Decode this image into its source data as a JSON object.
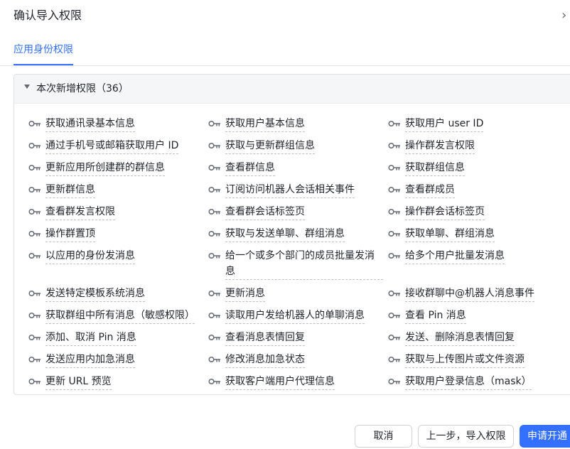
{
  "dialog": {
    "title": "确认导入权限",
    "close_icon": "chevron-right-icon"
  },
  "tabs": [
    {
      "label": "应用身份权限",
      "active": true
    }
  ],
  "panel": {
    "title": "本次新增权限（36）",
    "expanded": true
  },
  "permissions": [
    "获取通讯录基本信息",
    "获取用户基本信息",
    "获取用户 user ID",
    "通过手机号或邮箱获取用户 ID",
    "获取与更新群组信息",
    "操作群发言权限",
    "更新应用所创建群的群信息",
    "查看群信息",
    "获取群组信息",
    "更新群信息",
    "订阅访问机器人会话相关事件",
    "查看群成员",
    "查看群发言权限",
    "查看群会话标签页",
    "操作群会话标签页",
    "操作群置顶",
    "获取与发送单聊、群组消息",
    "获取单聊、群组消息",
    "以应用的身份发消息",
    "给一个或多个部门的成员批量发消息",
    "给多个用户批量发消息",
    "发送特定模板系统消息",
    "更新消息",
    "接收群聊中@机器人消息事件",
    "获取群组中所有消息（敏感权限）",
    "读取用户发给机器人的单聊消息",
    "查看 Pin 消息",
    "添加、取消 Pin 消息",
    "查看消息表情回复",
    "发送、删除消息表情回复",
    "发送应用内加急消息",
    "修改消息加急状态",
    "获取与上传图片或文件资源",
    "更新 URL 预览",
    "获取客户端用户代理信息",
    "获取用户登录信息（mask）"
  ],
  "footer": {
    "cancel_label": "取消",
    "prev_label": "上一步，导入权限",
    "apply_label": "申请开通"
  },
  "colors": {
    "accent": "#3370ff",
    "text": "#1f2329",
    "icon": "#646a73"
  }
}
